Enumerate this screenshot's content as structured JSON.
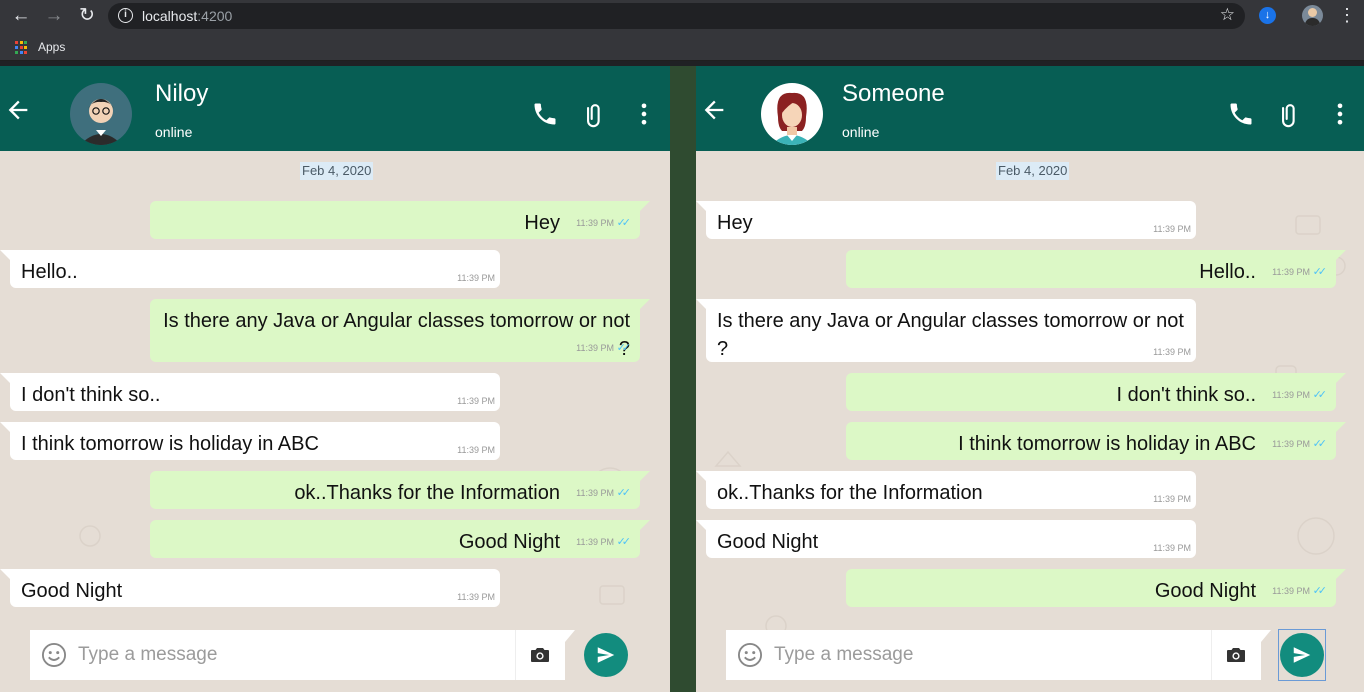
{
  "browser": {
    "url_host": "localhost",
    "url_port": ":4200",
    "bookmarks": {
      "apps_label": "Apps"
    }
  },
  "colors": {
    "header": "#075e54",
    "chat_bg": "#e5ddd5",
    "outgoing_bubble": "#dcf8c6",
    "incoming_bubble": "#ffffff",
    "send_button": "#128c7e",
    "read_ticks": "#4fc3f7",
    "divider": "#2f4b30"
  },
  "icons": {
    "back": "arrow-left-icon",
    "call": "phone-icon",
    "attach": "paperclip-icon",
    "menu": "more-vertical-icon",
    "emoji": "emoji-icon",
    "camera": "camera-icon",
    "send": "send-icon",
    "read_status": "double-check-icon"
  },
  "chats": [
    {
      "contact": {
        "name": "Niloy",
        "status": "online"
      },
      "date": "Feb 4, 2020",
      "messages": [
        {
          "dir": "out",
          "text": "Hey",
          "time": "11:39 PM"
        },
        {
          "dir": "in",
          "text": "Hello..",
          "time": "11:39 PM"
        },
        {
          "dir": "out",
          "text": "Is there any Java or Angular classes tomorrow or not ?",
          "time": "11:39 PM"
        },
        {
          "dir": "in",
          "text": "I don't think so..",
          "time": "11:39 PM"
        },
        {
          "dir": "in",
          "text": "I think tomorrow is holiday in ABC",
          "time": "11:39 PM"
        },
        {
          "dir": "out",
          "text": "ok..Thanks for the Information",
          "time": "11:39 PM"
        },
        {
          "dir": "out",
          "text": "Good Night",
          "time": "11:39 PM"
        },
        {
          "dir": "in",
          "text": "Good Night",
          "time": "11:39 PM"
        }
      ],
      "composer": {
        "placeholder": "Type a message"
      }
    },
    {
      "contact": {
        "name": "Someone",
        "status": "online"
      },
      "date": "Feb 4, 2020",
      "messages": [
        {
          "dir": "in",
          "text": "Hey",
          "time": "11:39 PM"
        },
        {
          "dir": "out",
          "text": "Hello..",
          "time": "11:39 PM"
        },
        {
          "dir": "in",
          "text": "Is there any Java or Angular classes tomorrow or not ?",
          "time": "11:39 PM"
        },
        {
          "dir": "out",
          "text": "I don't think so..",
          "time": "11:39 PM"
        },
        {
          "dir": "out",
          "text": "I think tomorrow is holiday in ABC",
          "time": "11:39 PM"
        },
        {
          "dir": "in",
          "text": "ok..Thanks for the Information",
          "time": "11:39 PM"
        },
        {
          "dir": "in",
          "text": "Good Night",
          "time": "11:39 PM"
        },
        {
          "dir": "out",
          "text": "Good Night",
          "time": "11:39 PM"
        }
      ],
      "composer": {
        "placeholder": "Type a message"
      }
    }
  ]
}
